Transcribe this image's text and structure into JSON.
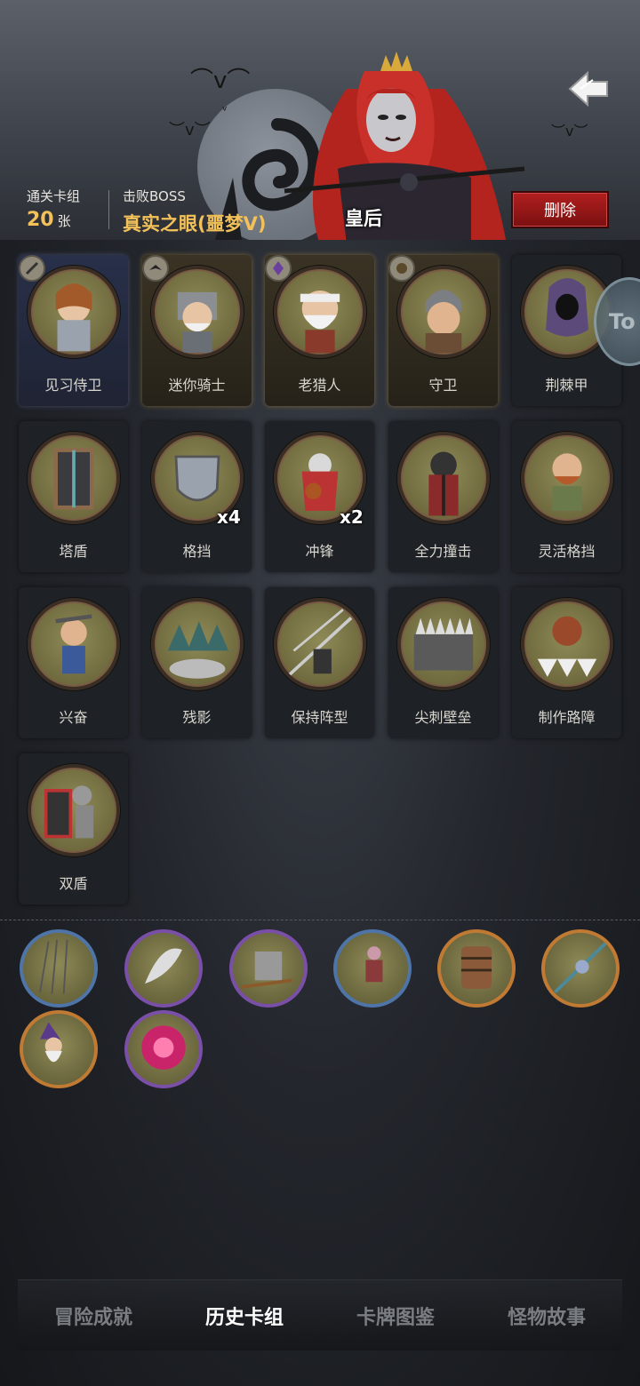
{
  "header": {
    "clear_deck_label": "通关卡组",
    "clear_deck_count": "20",
    "clear_deck_unit": "张",
    "defeat_boss_label": "击败BOSS",
    "boss_name": "真实之眼(噩梦V)",
    "character_name": "皇后",
    "delete_label": "删除",
    "back_icon": "back-arrow-icon"
  },
  "cards": [
    {
      "name": "见习侍卫",
      "style": "rare",
      "badge": "sword-badge-icon",
      "multiplier": ""
    },
    {
      "name": "迷你骑士",
      "style": "gold",
      "badge": "crow-badge-icon",
      "multiplier": ""
    },
    {
      "name": "老猎人",
      "style": "gold",
      "badge": "crystal-badge-icon",
      "multiplier": ""
    },
    {
      "name": "守卫",
      "style": "gold",
      "badge": "sun-badge-icon",
      "multiplier": ""
    },
    {
      "name": "荆棘甲",
      "style": "plain",
      "badge": "",
      "multiplier": ""
    },
    {
      "name": "塔盾",
      "style": "plain",
      "badge": "",
      "multiplier": ""
    },
    {
      "name": "格挡",
      "style": "plain",
      "badge": "",
      "multiplier": "x4"
    },
    {
      "name": "冲锋",
      "style": "plain",
      "badge": "",
      "multiplier": "x2"
    },
    {
      "name": "全力撞击",
      "style": "plain",
      "badge": "",
      "multiplier": ""
    },
    {
      "name": "灵活格挡",
      "style": "plain",
      "badge": "",
      "multiplier": ""
    },
    {
      "name": "兴奋",
      "style": "plain",
      "badge": "",
      "multiplier": ""
    },
    {
      "name": "残影",
      "style": "plain",
      "badge": "",
      "multiplier": ""
    },
    {
      "name": "保持阵型",
      "style": "plain",
      "badge": "",
      "multiplier": ""
    },
    {
      "name": "尖刺壁垒",
      "style": "plain",
      "badge": "",
      "multiplier": ""
    },
    {
      "name": "制作路障",
      "style": "plain",
      "badge": "",
      "multiplier": ""
    },
    {
      "name": "双盾",
      "style": "plain",
      "badge": "",
      "multiplier": ""
    }
  ],
  "relics": [
    {
      "icon": "arrows-relic-icon",
      "ring": "blue"
    },
    {
      "icon": "feather-relic-icon",
      "ring": "purple"
    },
    {
      "icon": "sword-shield-relic-icon",
      "ring": "purple"
    },
    {
      "icon": "runner-relic-icon",
      "ring": "blue"
    },
    {
      "icon": "chainmail-relic-icon",
      "ring": "orange"
    },
    {
      "icon": "spear-relic-icon",
      "ring": "orange"
    },
    {
      "icon": "wizard-relic-icon",
      "ring": "orange"
    },
    {
      "icon": "explosion-relic-icon",
      "ring": "purple"
    }
  ],
  "side_button": {
    "label": "To"
  },
  "tabs": [
    {
      "label": "冒险成就",
      "active": false
    },
    {
      "label": "历史卡组",
      "active": true
    },
    {
      "label": "卡牌图鉴",
      "active": false
    },
    {
      "label": "怪物故事",
      "active": false
    }
  ],
  "colors": {
    "gold_text": "#f3c15a",
    "delete_red": "#b21f1f",
    "ring_blue": "#4f74a8",
    "ring_purple": "#7a4fa8",
    "ring_orange": "#c07a33"
  }
}
